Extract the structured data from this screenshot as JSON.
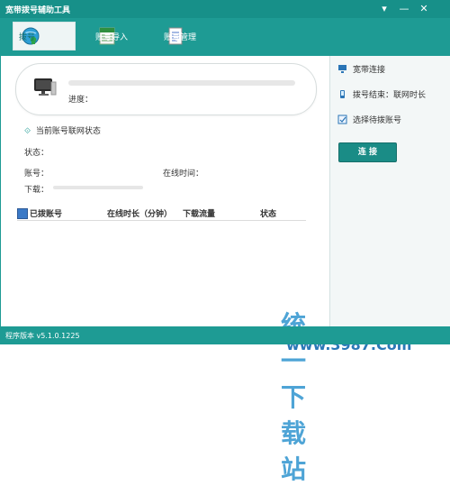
{
  "window": {
    "title": "宽带拨号辅助工具",
    "controls": [
      "▾",
      "—",
      "✕"
    ],
    "tabs": [
      {
        "label": "拨号",
        "icon": "globe-user-icon",
        "active": true
      },
      {
        "label": "账号导入",
        "icon": "excel-sheet-icon",
        "active": false
      },
      {
        "label": "账号管理",
        "icon": "document-list-icon",
        "active": false
      }
    ]
  },
  "card": {
    "progress_label": "进度：",
    "progress": 0
  },
  "status_panel": {
    "title": "当前账号联网状态",
    "state_label": "状态：",
    "account_label": "账号：",
    "online_time_label": "在线时间：",
    "download_label": "下载：",
    "download_progress": 0
  },
  "table": {
    "headers": [
      "已拨账号",
      "在线时长（分钟）",
      "下载流量",
      "状态"
    ],
    "rows": []
  },
  "sidebar": {
    "items": [
      {
        "label": "宽带连接",
        "icon": "monitor-icon"
      },
      {
        "label": "拨号结束：联网时长",
        "icon": "phone-icon"
      },
      {
        "label": "选择待拨账号",
        "icon": "checklist-icon"
      }
    ],
    "connect_button": "连 接"
  },
  "statusbar": {
    "version": "程序版本 v5.1.0.1225"
  },
  "watermark": {
    "title": "统一下载站",
    "url": "www.3987.Com"
  },
  "colors": {
    "primary": "#1e9b94",
    "primary_dark": "#1a8c86"
  }
}
